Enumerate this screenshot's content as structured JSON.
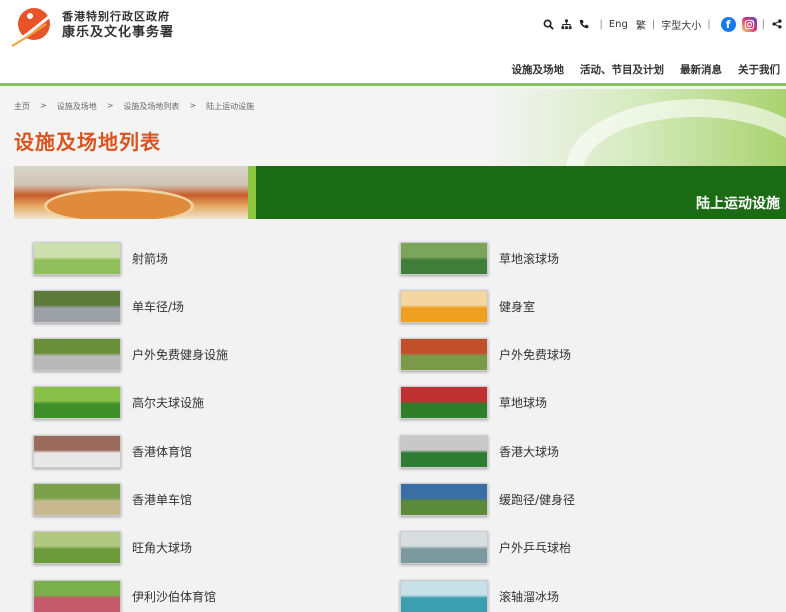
{
  "header": {
    "org_line1": "香港特别行政区政府",
    "org_line2": "康乐及文化事务署",
    "util": {
      "eng": "Eng",
      "trad": "繁",
      "font_size": "字型大小",
      "facebook_letter": "f"
    },
    "nav": [
      "设施及场地",
      "活动、节目及计划",
      "最新消息",
      "关于我们"
    ]
  },
  "breadcrumb": [
    "主页",
    ">",
    "设施及场地",
    ">",
    "设施及场地列表",
    ">",
    "陆上运动设施"
  ],
  "page_title": "设施及场地列表",
  "section_label": "陆上运动设施",
  "colors": {
    "accent_orange": "#d9541e",
    "dark_green": "#1b6b14",
    "lime": "#8dc63f"
  },
  "facilities": [
    {
      "name": "射箭场",
      "icon": "archery-range-photo"
    },
    {
      "name": "草地滚球场",
      "icon": "lawn-bowls-photo"
    },
    {
      "name": "单车径/场",
      "icon": "cycling-track-photo"
    },
    {
      "name": "健身室",
      "icon": "fitness-room-photo"
    },
    {
      "name": "户外免费健身设施",
      "icon": "outdoor-fitness-photo"
    },
    {
      "name": "户外免费球场",
      "icon": "outdoor-court-photo"
    },
    {
      "name": "高尔夫球设施",
      "icon": "golf-photo"
    },
    {
      "name": "草地球场",
      "icon": "grass-pitch-photo"
    },
    {
      "name": "香港体育馆",
      "icon": "hk-coliseum-photo"
    },
    {
      "name": "香港大球场",
      "icon": "hk-stadium-photo"
    },
    {
      "name": "香港单车馆",
      "icon": "velodrome-photo"
    },
    {
      "name": "缓跑径/健身径",
      "icon": "jogging-trail-photo"
    },
    {
      "name": "旺角大球场",
      "icon": "mong-kok-stadium-photo"
    },
    {
      "name": "户外乒乓球枱",
      "icon": "table-tennis-photo"
    },
    {
      "name": "伊利沙伯体育馆",
      "icon": "elizabeth-stadium-photo"
    },
    {
      "name": "滚轴溜冰场",
      "icon": "roller-rink-photo"
    }
  ]
}
